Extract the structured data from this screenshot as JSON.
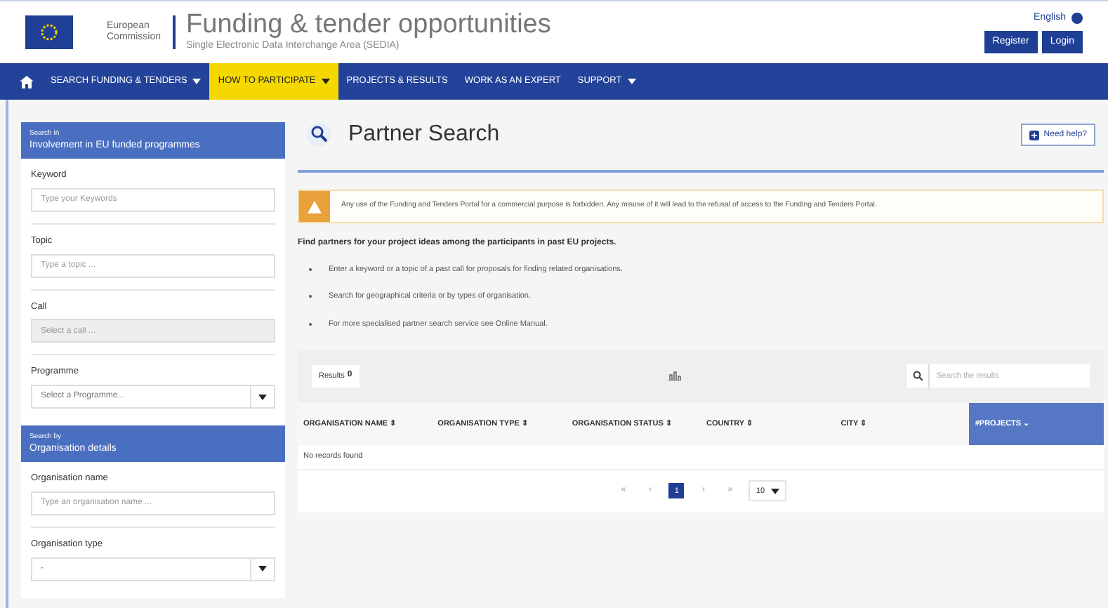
{
  "header": {
    "org_line1": "European",
    "org_line2": "Commission",
    "title": "Funding & tender opportunities",
    "subtitle": "Single Electronic Data Interchange Area (SEDIA)",
    "language": "English",
    "buttons": [
      "Register",
      "Login"
    ]
  },
  "nav": [
    {
      "label": "SEARCH FUNDING & TENDERS",
      "dropdown": true,
      "selected": false
    },
    {
      "label": "HOW TO PARTICIPATE",
      "dropdown": true,
      "selected": true
    },
    {
      "label": "PROJECTS & RESULTS",
      "dropdown": false,
      "selected": false
    },
    {
      "label": "WORK AS AN EXPERT",
      "dropdown": false,
      "selected": false
    },
    {
      "label": "SUPPORT",
      "dropdown": true,
      "selected": false
    }
  ],
  "sidebar": [
    {
      "kicker": "Search in",
      "title": "Involvement in EU funded programmes",
      "fields": [
        {
          "label": "Keyword",
          "placeholder": "Type your Keywords",
          "kind": "text",
          "disabled": false
        },
        {
          "label": "Topic",
          "placeholder": "Type a topic ...",
          "kind": "text",
          "disabled": false
        },
        {
          "label": "Call",
          "placeholder": "Select a call ...",
          "kind": "text",
          "disabled": true
        },
        {
          "label": "Programme",
          "placeholder": "Select a Programme...",
          "kind": "select",
          "disabled": false
        }
      ]
    },
    {
      "kicker": "Search by",
      "title": "Organisation details",
      "fields": [
        {
          "label": "Organisation name",
          "placeholder": "Type an organisation name ...",
          "kind": "text",
          "disabled": false
        },
        {
          "label": "Organisation type",
          "placeholder": "-",
          "kind": "select",
          "disabled": false
        }
      ]
    }
  ],
  "page": {
    "title": "Partner Search",
    "help_button": "Need help?",
    "warning": "Any use of the Funding and Tenders Portal for a commercial purpose is forbidden. Any misuse of it will lead to the refusal of access to the Funding and Tenders Portal.",
    "intro": "Find partners for your project ideas among the participants in past EU projects.",
    "bullets": [
      "Enter a keyword or a topic of a past call for proposals for finding related organisations.",
      "Search for geographical criteria or by types of organisation.",
      "For more specialised partner search service see Online Manual."
    ]
  },
  "results": {
    "count_label": "Results",
    "count": "0",
    "search_placeholder": "Search the results",
    "columns": [
      {
        "label": "ORGANISATION NAME ⇕",
        "selected": false
      },
      {
        "label": "ORGANISATION TYPE ⇕",
        "selected": false
      },
      {
        "label": "ORGANISATION STATUS ⇕",
        "selected": false
      },
      {
        "label": "COUNTRY ⇕",
        "selected": false
      },
      {
        "label": "CITY ⇕",
        "selected": false
      },
      {
        "label": "#PROJECTS ⌄",
        "selected": true
      }
    ],
    "empty": "No records found",
    "pagination": [
      {
        "label": "«",
        "selected": false
      },
      {
        "label": "‹",
        "selected": false
      },
      {
        "label": "1",
        "selected": true
      },
      {
        "label": "›",
        "selected": false
      },
      {
        "label": "»",
        "selected": false
      }
    ],
    "page_size": "10"
  }
}
